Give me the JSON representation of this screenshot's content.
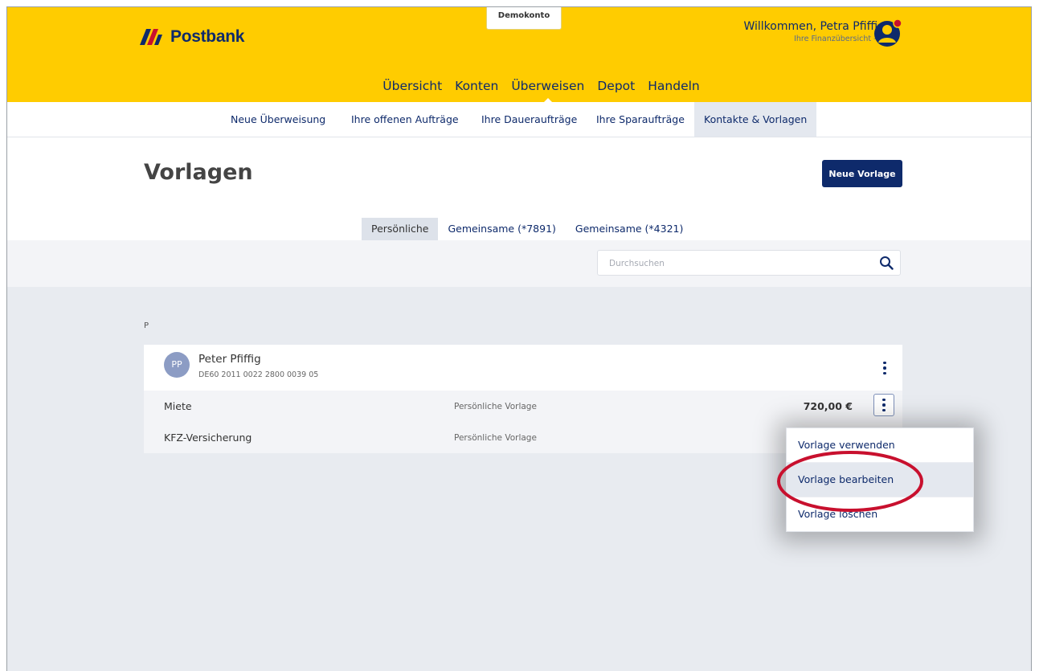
{
  "header": {
    "brand": "Postbank",
    "demo_label": "Demokonto",
    "welcome": "Willkommen, Petra Pfiffig",
    "welcome_sub": "Ihre Finanzübersicht -",
    "main_nav": [
      {
        "label": "Übersicht",
        "active": false
      },
      {
        "label": "Konten",
        "active": false
      },
      {
        "label": "Überweisen",
        "active": true
      },
      {
        "label": "Depot",
        "active": false
      },
      {
        "label": "Handeln",
        "active": false
      }
    ],
    "brand_color": "#ffcc00",
    "accent_color": "#0e2a6b"
  },
  "subnav": [
    {
      "label": "Neue Überweisung",
      "active": false
    },
    {
      "label": "Ihre offenen Aufträge",
      "active": false
    },
    {
      "label": "Ihre Daueraufträge",
      "active": false
    },
    {
      "label": "Ihre Sparaufträge",
      "active": false
    },
    {
      "label": "Kontakte & Vorlagen",
      "active": true
    }
  ],
  "page": {
    "title": "Vorlagen",
    "new_button": "Neue Vorlage",
    "tabs": [
      {
        "label": "Persönliche",
        "active": true
      },
      {
        "label": "Gemeinsame (*7891)",
        "active": false
      },
      {
        "label": "Gemeinsame (*4321)",
        "active": false
      }
    ],
    "search_placeholder": "Durchsuchen"
  },
  "list": {
    "group_letter": "P",
    "contact": {
      "initials": "PP",
      "name": "Peter Pfiffig",
      "iban": "DE60 2011 0022 2800 0039 05"
    },
    "templates": [
      {
        "name": "Miete",
        "type": "Persönliche Vorlage",
        "amount": "720,00 €"
      },
      {
        "name": "KFZ-Versicherung",
        "type": "Persönliche Vorlage",
        "amount": ""
      }
    ]
  },
  "dropdown": {
    "items": [
      {
        "label": "Vorlage verwenden",
        "hover": false
      },
      {
        "label": "Vorlage bearbeiten",
        "hover": true
      },
      {
        "label": "Vorlage löschen",
        "hover": false
      }
    ]
  },
  "icons": {
    "search": "search-icon",
    "menu": "kebab-menu-icon",
    "user": "user-avatar-icon",
    "logo": "postbank-logo-icon"
  },
  "highlight_color": "#c8102e"
}
